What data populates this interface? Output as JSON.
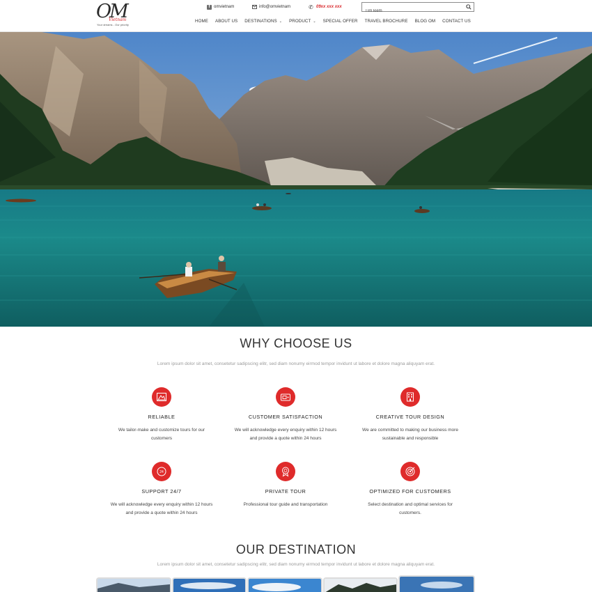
{
  "brand": {
    "logo_letters": "OM",
    "logo_script": "Vietnam",
    "tagline": "Your dreams - Our priority"
  },
  "topbar": {
    "facebook": "omvietnam",
    "email": "info@omvietnam",
    "phone": "09xx xxx xxx"
  },
  "search": {
    "placeholder": "Tìm kiếm"
  },
  "nav": [
    {
      "label": "HOME",
      "dropdown": false
    },
    {
      "label": "ABOUT US",
      "dropdown": false
    },
    {
      "label": "DESTINATIONS",
      "dropdown": true
    },
    {
      "label": "PRODUCT",
      "dropdown": true
    },
    {
      "label": "SPECIAL OFFER",
      "dropdown": false
    },
    {
      "label": "TRAVEL BROCHURE",
      "dropdown": false
    },
    {
      "label": "BLOG OM",
      "dropdown": false
    },
    {
      "label": "CONTACT US",
      "dropdown": false
    }
  ],
  "why": {
    "title": "WHY CHOOSE US",
    "subtitle": "Lorem ipsum dolor sit amet, consetetur sadipscing elitr, sed diam nonumy eirmod tempor invidunt ut labore et dolore magna aliquyam erat.",
    "features": [
      {
        "icon": "mountain-icon",
        "title": "RELIABLE",
        "desc_lines": [
          "We tailor-make and customize tours for our",
          "customers"
        ]
      },
      {
        "icon": "wallet-icon",
        "title": "CUSTOMER SATISFACTION",
        "desc_lines": [
          "We will acknowledge every enquiry within 12 hours",
          "and provide a quote within 24 hours"
        ]
      },
      {
        "icon": "building-icon",
        "title": "CREATIVE TOUR DESIGN",
        "desc_lines": [
          "We are committed to making our business more",
          "sustainable and responsible"
        ]
      },
      {
        "icon": "clock-24-icon",
        "title": "SUPPORT 24/7",
        "desc_lines": [
          "We will acknowledge every enquiry within 12 hours",
          "and provide a quote within 24 hours"
        ]
      },
      {
        "icon": "award-icon",
        "title": "PRIVATE TOUR",
        "desc_lines": [
          "Professional tour guide and transportation"
        ]
      },
      {
        "icon": "target-icon",
        "title": "OPTIMIZED FOR CUSTOMERS",
        "desc_lines": [
          "Select destination and optimal services for",
          "customers."
        ]
      }
    ]
  },
  "destination": {
    "title": "OUR DESTINATION",
    "subtitle": "Lorem ipsum dolor sit amet, consetetur sadipscing elitr, sed diam nonumy eirmod tempor invidunt ut labore et dolore magna aliquyam erat."
  },
  "colors": {
    "accent": "#df2b2b",
    "lake": "#1f7f80",
    "text": "#333333"
  }
}
